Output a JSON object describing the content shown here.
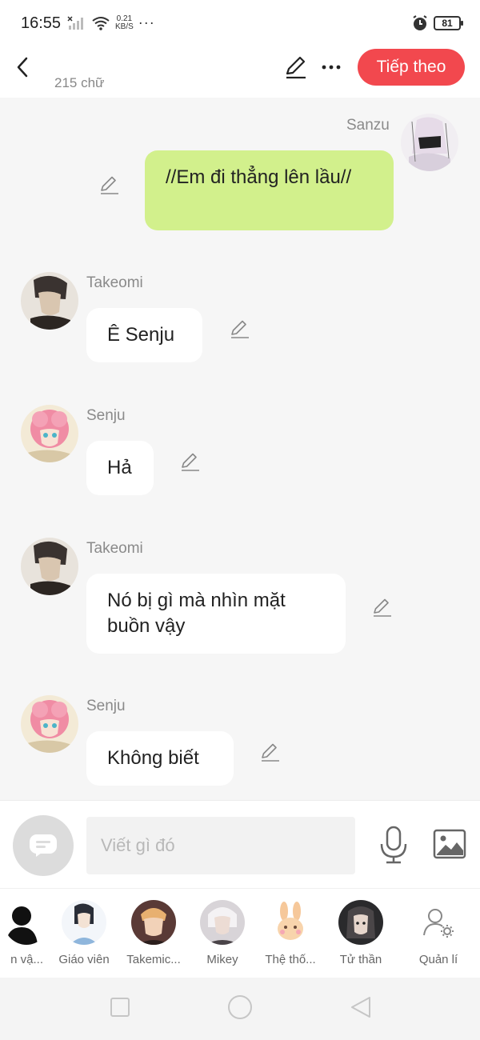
{
  "status_bar": {
    "time": "16:55",
    "speed_value": "0.21",
    "speed_unit": "KB/S",
    "dots": "···",
    "battery": "81"
  },
  "header": {
    "word_count": "215 chữ",
    "next_label": "Tiếp theo"
  },
  "messages": [
    {
      "sender": "Sanzu",
      "text": "//Em đi thẳng lên lầu//",
      "side": "right",
      "bubble_color": "#d2f08c"
    },
    {
      "sender": "Takeomi",
      "text": "Ê Senju",
      "side": "left",
      "bubble_color": "#ffffff"
    },
    {
      "sender": "Senju",
      "text": "Hả",
      "side": "left",
      "bubble_color": "#ffffff"
    },
    {
      "sender": "Takeomi",
      "text": "Nó bị gì mà nhìn mặt buồn vậy",
      "side": "left",
      "bubble_color": "#ffffff"
    },
    {
      "sender": "Senju",
      "text": "Không biết",
      "side": "left",
      "bubble_color": "#ffffff"
    }
  ],
  "input": {
    "placeholder": "Viết gì đó"
  },
  "characters": [
    {
      "name": "n vậ..."
    },
    {
      "name": "Giáo viên"
    },
    {
      "name": "Takemic..."
    },
    {
      "name": "Mikey"
    },
    {
      "name": "Thệ thố..."
    },
    {
      "name": "Tử thần"
    },
    {
      "name": "Quản lí"
    }
  ],
  "colors": {
    "accent": "#f2484e",
    "own_bubble": "#d2f08c",
    "other_bubble": "#ffffff",
    "chat_bg": "#f6f6f6"
  }
}
